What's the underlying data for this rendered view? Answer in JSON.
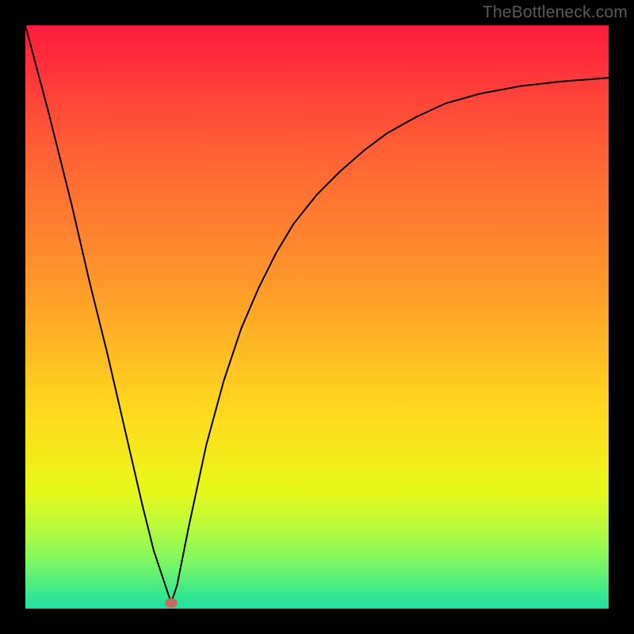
{
  "watermark": "TheBottleneck.com",
  "chart_data": {
    "type": "line",
    "title": "",
    "xlabel": "",
    "ylabel": "",
    "xlim": [
      0,
      100
    ],
    "ylim": [
      0,
      100
    ],
    "x": [
      0,
      4,
      8,
      11,
      14,
      17,
      20,
      22,
      24,
      25,
      26,
      28,
      31,
      34,
      37,
      40,
      43,
      46,
      50,
      54,
      58,
      62,
      67,
      72,
      78,
      85,
      92,
      100
    ],
    "values": [
      100,
      85,
      69,
      56,
      44,
      31,
      18,
      10,
      4,
      1,
      4,
      14,
      28,
      39,
      48,
      55,
      61,
      66,
      71,
      75,
      78.5,
      81.5,
      84.3,
      86.6,
      88.3,
      89.6,
      90.4,
      91
    ],
    "annotations": [
      {
        "name": "min-marker",
        "x": 25,
        "y": 1
      }
    ]
  }
}
